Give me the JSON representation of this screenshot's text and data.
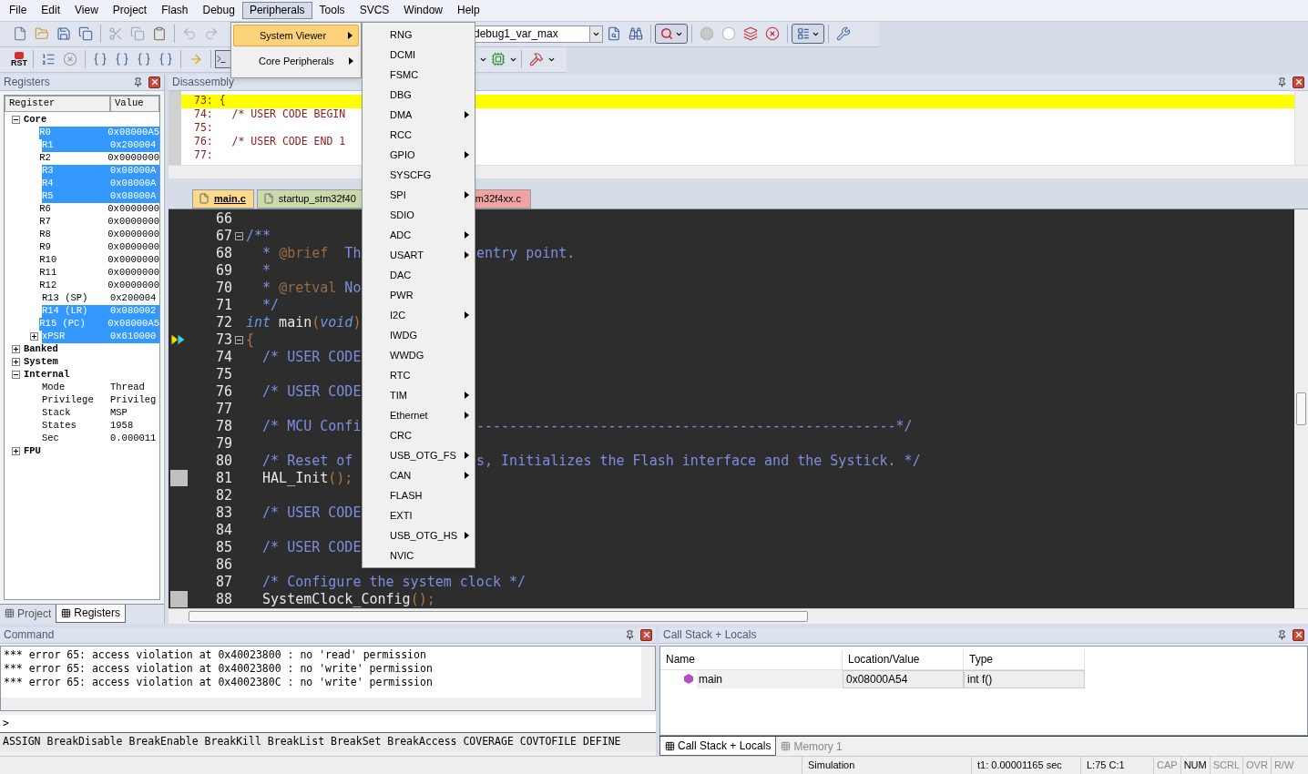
{
  "menu_bar": [
    {
      "label": "File",
      "selected": false
    },
    {
      "label": "Edit",
      "selected": false
    },
    {
      "label": "View",
      "selected": false
    },
    {
      "label": "Project",
      "selected": false
    },
    {
      "label": "Flash",
      "selected": false
    },
    {
      "label": "Debug",
      "selected": false
    },
    {
      "label": "Peripherals",
      "selected": true
    },
    {
      "label": "Tools",
      "selected": false
    },
    {
      "label": "SVCS",
      "selected": false
    },
    {
      "label": "Window",
      "selected": false
    },
    {
      "label": "Help",
      "selected": false
    }
  ],
  "peripherals_menu": [
    {
      "label": "System Viewer",
      "selected": true,
      "has_submenu": true
    },
    {
      "label": "Core Peripherals",
      "selected": false,
      "has_submenu": true
    }
  ],
  "system_viewer_menu": [
    {
      "label": "RNG",
      "has_submenu": false
    },
    {
      "label": "DCMI",
      "has_submenu": false
    },
    {
      "label": "FSMC",
      "has_submenu": false
    },
    {
      "label": "DBG",
      "has_submenu": false
    },
    {
      "label": "DMA",
      "has_submenu": true
    },
    {
      "label": "RCC",
      "has_submenu": false
    },
    {
      "label": "GPIO",
      "has_submenu": true
    },
    {
      "label": "SYSCFG",
      "has_submenu": false
    },
    {
      "label": "SPI",
      "has_submenu": true
    },
    {
      "label": "SDIO",
      "has_submenu": false
    },
    {
      "label": "ADC",
      "has_submenu": true
    },
    {
      "label": "USART",
      "has_submenu": true
    },
    {
      "label": "DAC",
      "has_submenu": false
    },
    {
      "label": "PWR",
      "has_submenu": false
    },
    {
      "label": "I2C",
      "has_submenu": true
    },
    {
      "label": "IWDG",
      "has_submenu": false
    },
    {
      "label": "WWDG",
      "has_submenu": false
    },
    {
      "label": "RTC",
      "has_submenu": false
    },
    {
      "label": "TIM",
      "has_submenu": true
    },
    {
      "label": "Ethernet",
      "has_submenu": true
    },
    {
      "label": "CRC",
      "has_submenu": false
    },
    {
      "label": "USB_OTG_FS",
      "has_submenu": true
    },
    {
      "label": "CAN",
      "has_submenu": true
    },
    {
      "label": "FLASH",
      "has_submenu": false
    },
    {
      "label": "EXTI",
      "has_submenu": false
    },
    {
      "label": "USB_OTG_HS",
      "has_submenu": true
    },
    {
      "label": "NVIC",
      "has_submenu": false
    }
  ],
  "toolbar": {
    "target_field": {
      "value": "debug1_var_max"
    },
    "reset_label": "RST"
  },
  "registers_panel": {
    "title": "Registers",
    "columns": [
      "Register",
      "Value"
    ],
    "tree": [
      {
        "name": "Core",
        "expanded": true,
        "children": [
          {
            "name": "R0",
            "value": "0x08000A5",
            "selected": true
          },
          {
            "name": "R1",
            "value": "0x200004",
            "selected": true
          },
          {
            "name": "R2",
            "value": "0x0000000",
            "selected": false
          },
          {
            "name": "R3",
            "value": "0x08000A",
            "selected": true
          },
          {
            "name": "R4",
            "value": "0x08000A",
            "selected": true
          },
          {
            "name": "R5",
            "value": "0x08000A",
            "selected": true
          },
          {
            "name": "R6",
            "value": "0x0000000",
            "selected": false
          },
          {
            "name": "R7",
            "value": "0x0000000",
            "selected": false
          },
          {
            "name": "R8",
            "value": "0x0000000",
            "selected": false
          },
          {
            "name": "R9",
            "value": "0x0000000",
            "selected": false
          },
          {
            "name": "R10",
            "value": "0x0000000",
            "selected": false
          },
          {
            "name": "R11",
            "value": "0x0000000",
            "selected": false
          },
          {
            "name": "R12",
            "value": "0x0000000",
            "selected": false
          },
          {
            "name": "R13 (SP)",
            "value": "0x200004",
            "selected": false
          },
          {
            "name": "R14 (LR)",
            "value": "0x080002",
            "selected": true
          },
          {
            "name": "R15 (PC)",
            "value": "0x08000A5",
            "selected": true
          },
          {
            "name": "xPSR",
            "value": "0x610000",
            "selected": true,
            "expanded": false
          }
        ]
      },
      {
        "name": "Banked",
        "expanded": false
      },
      {
        "name": "System",
        "expanded": false
      },
      {
        "name": "Internal",
        "expanded": true,
        "children": [
          {
            "name": "Mode",
            "value": "Thread",
            "selected": false
          },
          {
            "name": "Privilege",
            "value": "Privileg",
            "selected": false
          },
          {
            "name": "Stack",
            "value": "MSP",
            "selected": false
          },
          {
            "name": "States",
            "value": "1958",
            "selected": false
          },
          {
            "name": "Sec",
            "value": "0.000011",
            "selected": false
          }
        ]
      },
      {
        "name": "FPU",
        "expanded": false
      }
    ]
  },
  "left_panel_tabs": [
    {
      "label": "Project",
      "selected": false
    },
    {
      "label": "Registers",
      "selected": true
    }
  ],
  "disassembly": {
    "title": "Disassembly",
    "lines": [
      {
        "text": "73: {",
        "current": true
      },
      {
        "text": "74:   /* USER CODE BEGIN",
        "current": false
      },
      {
        "text": "75:",
        "current": false
      },
      {
        "text": "76:   /* USER CODE END 1",
        "current": false
      },
      {
        "text": "77:",
        "current": false
      }
    ]
  },
  "editor_tabs": [
    {
      "label": "main.c",
      "selected": true,
      "color": "#fcd98c"
    },
    {
      "label": "startup_stm32f40",
      "selected": false,
      "color": "#c9d9a9"
    },
    {
      "label": "m32f4xx.c",
      "selected": false,
      "color": "#f0a3a3"
    }
  ],
  "code_lines": [
    {
      "number": "66",
      "fold": false,
      "current": false,
      "executable": false
    },
    {
      "number": "67",
      "fold": true,
      "current": false,
      "executable": false,
      "left": [
        {
          "text": "/**",
          "kind": "comment"
        }
      ]
    },
    {
      "number": "68",
      "fold": false,
      "current": false,
      "executable": false,
      "left": [
        {
          "text": "  * ",
          "kind": "comment"
        },
        {
          "text": "@brief",
          "kind": "tag"
        },
        {
          "text": "  Th",
          "kind": "comment"
        }
      ],
      "right": [
        {
          "text": "entry point.",
          "kind": "comment"
        }
      ]
    },
    {
      "number": "69",
      "fold": false,
      "current": false,
      "executable": false,
      "left": [
        {
          "text": "  *",
          "kind": "comment"
        }
      ]
    },
    {
      "number": "70",
      "fold": false,
      "current": false,
      "executable": false,
      "left": [
        {
          "text": "  * ",
          "kind": "comment"
        },
        {
          "text": "@retval",
          "kind": "tag"
        },
        {
          "text": " No",
          "kind": "comment"
        }
      ]
    },
    {
      "number": "71",
      "fold": false,
      "current": false,
      "executable": false,
      "left": [
        {
          "text": "  */",
          "kind": "comment"
        }
      ]
    },
    {
      "number": "72",
      "fold": false,
      "current": false,
      "executable": false,
      "left": [
        {
          "text": "int",
          "kind": "keyword"
        },
        {
          "text": " main",
          "kind": "plain"
        },
        {
          "text": "(",
          "kind": "punct"
        },
        {
          "text": "void",
          "kind": "keyword"
        },
        {
          "text": ")",
          "kind": "punct"
        }
      ]
    },
    {
      "number": "73",
      "fold": true,
      "current": true,
      "executable": true,
      "left": [
        {
          "text": "{",
          "kind": "punct"
        }
      ]
    },
    {
      "number": "74",
      "fold": false,
      "current": false,
      "executable": false,
      "left": [
        {
          "text": "  /* USER CODE",
          "kind": "comment"
        }
      ]
    },
    {
      "number": "75",
      "fold": false,
      "current": false,
      "executable": false
    },
    {
      "number": "76",
      "fold": false,
      "current": false,
      "executable": false,
      "left": [
        {
          "text": "  /* USER CODE",
          "kind": "comment"
        }
      ]
    },
    {
      "number": "77",
      "fold": false,
      "current": false,
      "executable": false
    },
    {
      "number": "78",
      "fold": false,
      "current": false,
      "executable": false,
      "left": [
        {
          "text": "  /* MCU Confi",
          "kind": "comment"
        }
      ],
      "right": [
        {
          "text": "---------------------------------------------------*/",
          "kind": "comment"
        }
      ]
    },
    {
      "number": "79",
      "fold": false,
      "current": false,
      "executable": false
    },
    {
      "number": "80",
      "fold": false,
      "current": false,
      "executable": false,
      "left": [
        {
          "text": "  /* Reset of",
          "kind": "comment"
        }
      ],
      "right": [
        {
          "text": "s, Initializes the Flash interface and the Systick. */",
          "kind": "comment"
        }
      ]
    },
    {
      "number": "81",
      "fold": false,
      "current": false,
      "executable": true,
      "left": [
        {
          "text": "  HAL_Init",
          "kind": "plain"
        },
        {
          "text": "();",
          "kind": "punct"
        }
      ]
    },
    {
      "number": "82",
      "fold": false,
      "current": false,
      "executable": false
    },
    {
      "number": "83",
      "fold": false,
      "current": false,
      "executable": false,
      "left": [
        {
          "text": "  /* USER CODE",
          "kind": "comment"
        }
      ]
    },
    {
      "number": "84",
      "fold": false,
      "current": false,
      "executable": false
    },
    {
      "number": "85",
      "fold": false,
      "current": false,
      "executable": false,
      "left": [
        {
          "text": "  /* USER CODE",
          "kind": "comment"
        }
      ]
    },
    {
      "number": "86",
      "fold": false,
      "current": false,
      "executable": false
    },
    {
      "number": "87",
      "fold": false,
      "current": false,
      "executable": false,
      "left": [
        {
          "text": "  /* Configure the system clock */",
          "kind": "comment"
        }
      ]
    },
    {
      "number": "88",
      "fold": false,
      "current": false,
      "executable": true,
      "left": [
        {
          "text": "  SystemClock_Config",
          "kind": "plain"
        },
        {
          "text": "();",
          "kind": "punct"
        }
      ]
    }
  ],
  "command": {
    "title": "Command",
    "lines": [
      "*** error 65: access violation at 0x40023800 : no 'read' permission",
      "*** error 65: access violation at 0x40023800 : no 'write' permission",
      "*** error 65: access violation at 0x4002380C : no 'write' permission"
    ],
    "prompt": ">",
    "commands": "ASSIGN BreakDisable BreakEnable BreakKill BreakList BreakSet BreakAccess COVERAGE COVTOFILE DEFINE"
  },
  "call_stack": {
    "title": "Call Stack + Locals",
    "columns": [
      "Name",
      "Location/Value",
      "Type"
    ],
    "rows": [
      {
        "name": "main",
        "location": "0x08000A54",
        "type": "int f()"
      }
    ],
    "tabs": [
      {
        "label": "Call Stack + Locals",
        "selected": true
      },
      {
        "label": "Memory 1",
        "selected": false
      }
    ]
  },
  "status_bar": {
    "fields": [
      "Simulation",
      "t1: 0.00001165 sec",
      "L:75 C:1"
    ],
    "indicators": [
      {
        "label": "CAP",
        "on": false
      },
      {
        "label": "NUM",
        "on": true
      },
      {
        "label": "SCRL",
        "on": false
      },
      {
        "label": "OVR",
        "on": false
      },
      {
        "label": "R/W",
        "on": false
      }
    ]
  }
}
